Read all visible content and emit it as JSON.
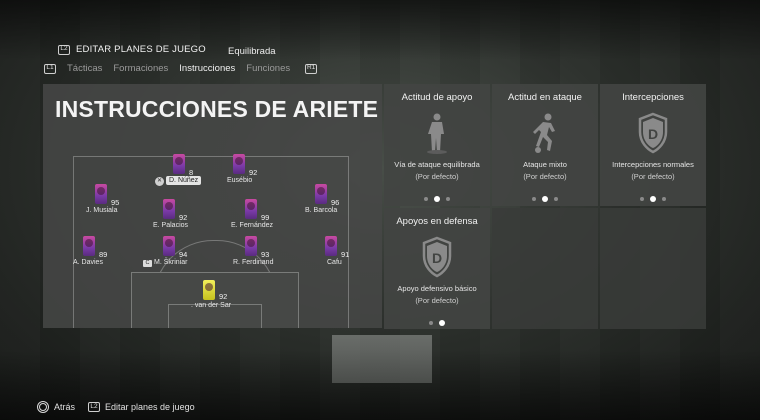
{
  "header": {
    "l2_badge": "L2",
    "title": "EDITAR PLANES DE JUEGO",
    "subtitle": "Equilibrada"
  },
  "tabs": {
    "l1_badge": "L1",
    "r1_badge": "R1",
    "items": [
      "Tácticas",
      "Formaciones",
      "Instrucciones",
      "Funciones"
    ],
    "active": "Instrucciones"
  },
  "panel": {
    "title": "INSTRUCCIONES DE ARIETE"
  },
  "players": [
    {
      "name": "D. Núñez",
      "rating": "8",
      "selected": true
    },
    {
      "name": "Eusébio",
      "rating": "92"
    },
    {
      "name": "J. Musiala",
      "rating": "95"
    },
    {
      "name": "E. Palacios",
      "rating": "92"
    },
    {
      "name": "E. Fernández",
      "rating": "99"
    },
    {
      "name": "B. Barcola",
      "rating": "96"
    },
    {
      "name": "A. Davies",
      "rating": "89"
    },
    {
      "name": "M. Škriniar",
      "rating": "94"
    },
    {
      "name": "R. Ferdinand",
      "rating": "93"
    },
    {
      "name": "Cafu",
      "rating": "91"
    },
    {
      "name": ". van der Sar",
      "rating": "92",
      "goalkeeper": true
    }
  ],
  "tiles": [
    {
      "title": "Actitud de apoyo",
      "label": "Vía de ataque equilibrada",
      "sub": "(Por defecto)",
      "icon": "standing-player-icon",
      "dots": 3,
      "active_dot": 1
    },
    {
      "title": "Actitud en ataque",
      "label": "Ataque mixto",
      "sub": "(Por defecto)",
      "icon": "running-player-icon",
      "dots": 3,
      "active_dot": 1
    },
    {
      "title": "Intercepciones",
      "label": "Intercepciones normales",
      "sub": "(Por defecto)",
      "icon": "defense-shield-icon",
      "dots": 3,
      "active_dot": 1
    },
    {
      "title": "Apoyos en defensa",
      "label": "Apoyo defensivo básico",
      "sub": "(Por defecto)",
      "icon": "defense-shield-icon",
      "dots": 2,
      "active_dot": 1
    }
  ],
  "footer": {
    "back_label": "Atrás",
    "l2_badge": "L2",
    "edit_label": "Editar planes de juego"
  },
  "colors": {
    "card_special": "#7a3aa8",
    "card_goalkeeper": "#e8e440",
    "panel": "#464846"
  }
}
